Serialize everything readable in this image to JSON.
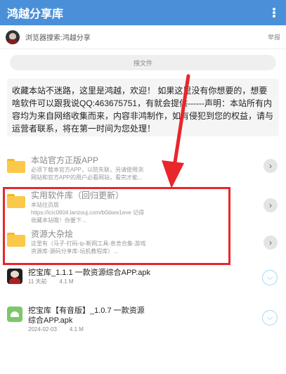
{
  "appbar": {
    "title": "鸿越分享库",
    "menu_icon": "more-vertical-icon"
  },
  "share": {
    "text": "浏览器搜索:鸿越分享",
    "report": "举报"
  },
  "search": {
    "label": "搜文件"
  },
  "notice": {
    "text": "收藏本站不迷路，这里是鸿越，欢迎！ 如果这里没有你想要的，想要啥软件可以跟我说QQ:463675751，有就会提供------声明：本站所有内容均为来自网络收集而来，内容非鸿制作，如有侵犯到您的权益，请与运营者联系，将在第一时间为您处理！"
  },
  "folders": [
    {
      "title": "本站官方正版APP",
      "desc1": "必须下载本官方APP，以防失联，另请使用浏",
      "desc2": "网站和官方APP的用户必看网站，看完才能..."
    },
    {
      "title": "实用软件库（回归更新）",
      "desc1": "本站往员版",
      "desc2": "https://icic0604.lanzouj.com/b0dww1eve 记得",
      "desc3": "收藏本站哦！你要下..."
    },
    {
      "title": "资源大杂烩",
      "desc1": "这里有（马子-打码-ip-断网工具-息舍合集-游戏",
      "desc2": "资源库-源码分享库-玩机教程库）..."
    }
  ],
  "files": [
    {
      "title": "挖宝库_1.1.1 一款资源综合APP.apk",
      "date": "11 天前",
      "size": "4.1 M"
    },
    {
      "title_line1": "挖宝库【有音版】_1.0.7 一款资源",
      "title_line2": "综合APP.apk",
      "date": "2024-02-03",
      "size": "4.1 M"
    }
  ],
  "colors": {
    "appbar": "#4a90d9",
    "annotation": "#e8262c"
  }
}
